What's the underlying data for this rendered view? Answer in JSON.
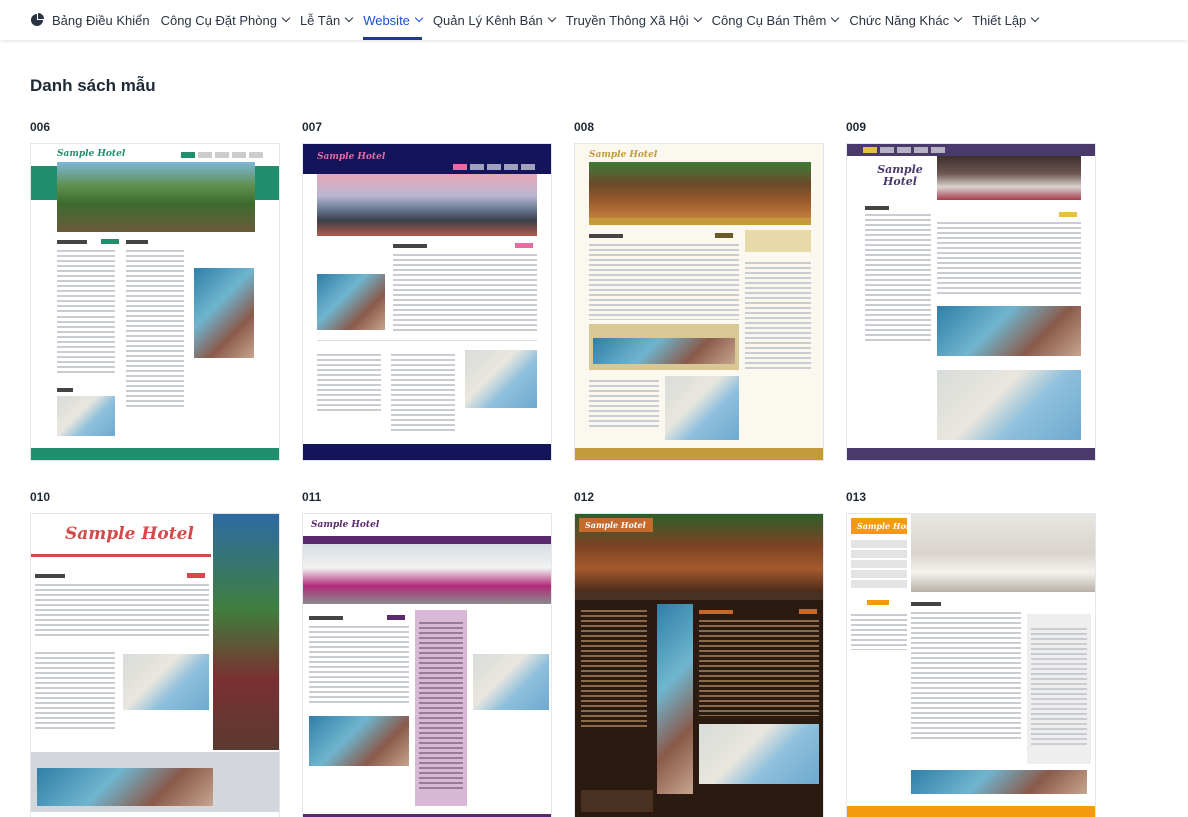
{
  "nav": {
    "items": [
      {
        "label": "Bảng Điều Khiển",
        "chevron": false,
        "active": false,
        "icon": "dashboard-icon"
      },
      {
        "label": "Công Cụ Đặt Phòng",
        "chevron": true,
        "active": false
      },
      {
        "label": "Lễ Tân",
        "chevron": true,
        "active": false
      },
      {
        "label": "Website",
        "chevron": true,
        "active": true
      },
      {
        "label": "Quản Lý Kênh Bán",
        "chevron": true,
        "active": false
      },
      {
        "label": "Truyền Thông Xã Hội",
        "chevron": true,
        "active": false
      },
      {
        "label": "Công Cụ Bán Thêm",
        "chevron": true,
        "active": false
      },
      {
        "label": "Chức Năng Khác",
        "chevron": true,
        "active": false
      },
      {
        "label": "Thiết Lập",
        "chevron": true,
        "active": false
      }
    ],
    "accent_color": "#1e3a8a"
  },
  "page": {
    "title": "Danh sách mẫu"
  },
  "templates": [
    {
      "code": "006",
      "logo": "Sample Hotel",
      "theme": "#1f8f6e"
    },
    {
      "code": "007",
      "logo": "Sample Hotel",
      "theme": "#14145a"
    },
    {
      "code": "008",
      "logo": "Sample Hotel",
      "theme": "#c49a3a"
    },
    {
      "code": "009",
      "logo": "Sample Hotel",
      "theme": "#4a3a6b"
    },
    {
      "code": "010",
      "logo": "Sample Hotel",
      "theme": "#d44a4a"
    },
    {
      "code": "011",
      "logo": "Sample Hotel",
      "theme": "#5a2a6e"
    },
    {
      "code": "012",
      "logo": "Sample Hotel",
      "theme": "#3a2414"
    },
    {
      "code": "013",
      "logo": "Sample Hotel",
      "theme": "#f59a0a"
    }
  ]
}
